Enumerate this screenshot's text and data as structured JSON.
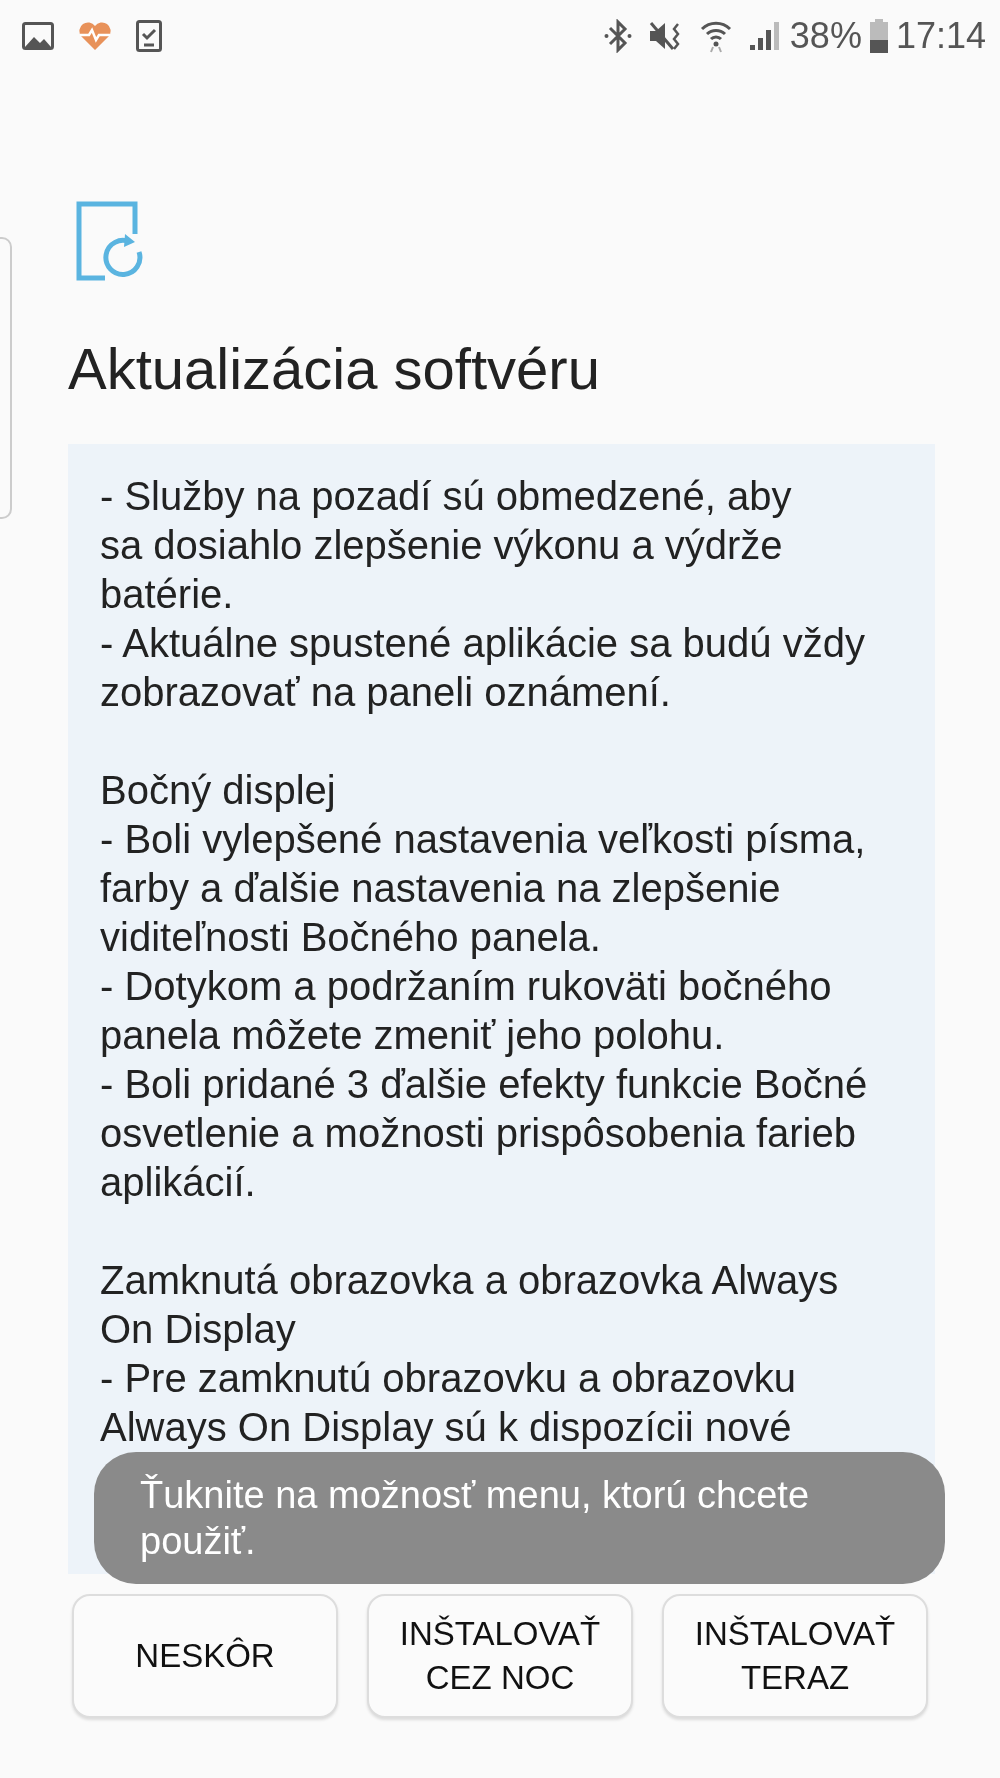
{
  "status_bar": {
    "battery": "38%",
    "time": "17:14"
  },
  "title": "Aktualizácia softvéru",
  "sections": [
    {
      "items": [
        [
          "- Služby na pozadí sú obmedzené, aby",
          "sa dosiahlo zlepšenie výkonu a výdrže",
          "batérie."
        ],
        [
          "- Aktuálne spustené aplikácie sa budú vždy",
          "zobrazovať na paneli oznámení."
        ]
      ]
    },
    {
      "heading": "Bočný displej",
      "items": [
        [
          "- Boli vylepšené nastavenia veľkosti písma,",
          "farby a ďalšie nastavenia na zlepšenie",
          "viditeľnosti Bočného panela."
        ],
        [
          "- Dotykom a podržaním rukoväti bočného",
          "panela môžete zmeniť jeho polohu."
        ],
        [
          "- Boli pridané 3 ďalšie efekty funkcie Bočné",
          "osvetlenie a možnosti prispôsobenia farieb",
          "aplikácií."
        ]
      ]
    },
    {
      "heading": "Zamknutá obrazovka a obrazovka Always On Display",
      "items": [
        [
          "- Pre zamknutú obrazovku a obrazovku",
          "Always On Display sú k dispozícii nové"
        ]
      ]
    }
  ],
  "toast": "Ťuknite na možnosť menu, ktorú chcete použiť.",
  "buttons": [
    [
      "NESKÔR"
    ],
    [
      "INŠTALOVAŤ",
      "CEZ NOC"
    ],
    [
      "INŠTALOVAŤ",
      "TERAZ"
    ]
  ]
}
